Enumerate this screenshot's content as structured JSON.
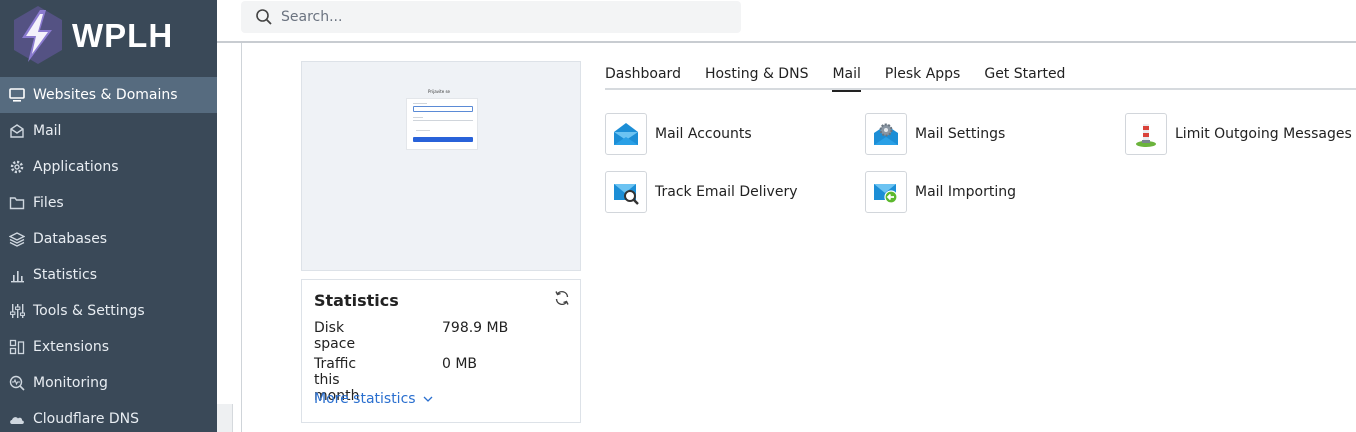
{
  "brand": {
    "name": "WPLH"
  },
  "search": {
    "placeholder": "Search..."
  },
  "sidebar": {
    "items": [
      {
        "label": "Websites & Domains",
        "icon": "monitor-icon",
        "active": true
      },
      {
        "label": "Mail",
        "icon": "envelope-icon",
        "active": false
      },
      {
        "label": "Applications",
        "icon": "gear-icon",
        "active": false
      },
      {
        "label": "Files",
        "icon": "folder-icon",
        "active": false
      },
      {
        "label": "Databases",
        "icon": "layers-icon",
        "active": false
      },
      {
        "label": "Statistics",
        "icon": "bar-chart-icon",
        "active": false
      },
      {
        "label": "Tools & Settings",
        "icon": "sliders-icon",
        "active": false
      },
      {
        "label": "Extensions",
        "icon": "blocks-icon",
        "active": false
      },
      {
        "label": "Monitoring",
        "icon": "magnifier-pulse-icon",
        "active": false
      },
      {
        "label": "Cloudflare DNS",
        "icon": "cloud-icon",
        "active": false
      }
    ]
  },
  "preview": {
    "mini_title": "Prijavite se"
  },
  "stats": {
    "title": "Statistics",
    "rows": [
      {
        "label": "Disk space",
        "value": "798.9 MB"
      },
      {
        "label": "Traffic this month",
        "value": "0 MB"
      }
    ],
    "more_label": "More statistics"
  },
  "tabs": [
    {
      "label": "Dashboard",
      "active": false
    },
    {
      "label": "Hosting & DNS",
      "active": false
    },
    {
      "label": "Mail",
      "active": true
    },
    {
      "label": "Plesk Apps",
      "active": false
    },
    {
      "label": "Get Started",
      "active": false
    }
  ],
  "tools": [
    {
      "label": "Mail Accounts",
      "icon": "mail-accounts-icon"
    },
    {
      "label": "Mail Settings",
      "icon": "mail-settings-icon"
    },
    {
      "label": "Limit Outgoing Messages",
      "icon": "limit-outgoing-icon"
    },
    {
      "label": "Track Email Delivery",
      "icon": "track-email-icon"
    },
    {
      "label": "Mail Importing",
      "icon": "mail-importing-icon"
    }
  ],
  "colors": {
    "sidebar_bg": "#3a4958",
    "sidebar_active": "#566b7f",
    "link": "#2a6fcf",
    "mail_icon_blue": "#1c8ed6"
  }
}
